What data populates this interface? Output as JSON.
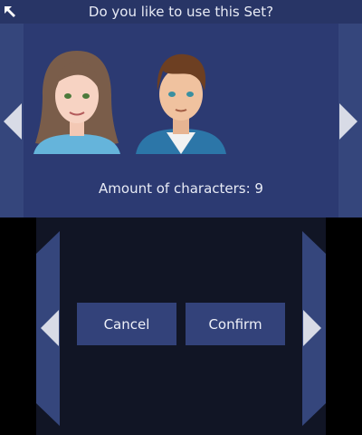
{
  "dialog": {
    "title": "Do you like to use this Set?",
    "amount_text": "Amount of characters: 9"
  },
  "characters": [
    {
      "icon": "female-avatar-icon",
      "hair": "#7a5d4a",
      "shirt": "#65b4db"
    },
    {
      "icon": "male-avatar-icon",
      "hair": "#6d3f22",
      "shirt": "#2c76a8"
    }
  ],
  "buttons": {
    "cancel_label": "Cancel",
    "confirm_label": "Confirm"
  },
  "icons": {
    "back": "back-arrow-icon",
    "prev": "chevron-left-icon",
    "next": "chevron-right-icon"
  },
  "colors": {
    "top_background": "#2c3a72",
    "bottom_background": "#111525",
    "button": "#33427a",
    "text": "#e8ebf5"
  }
}
